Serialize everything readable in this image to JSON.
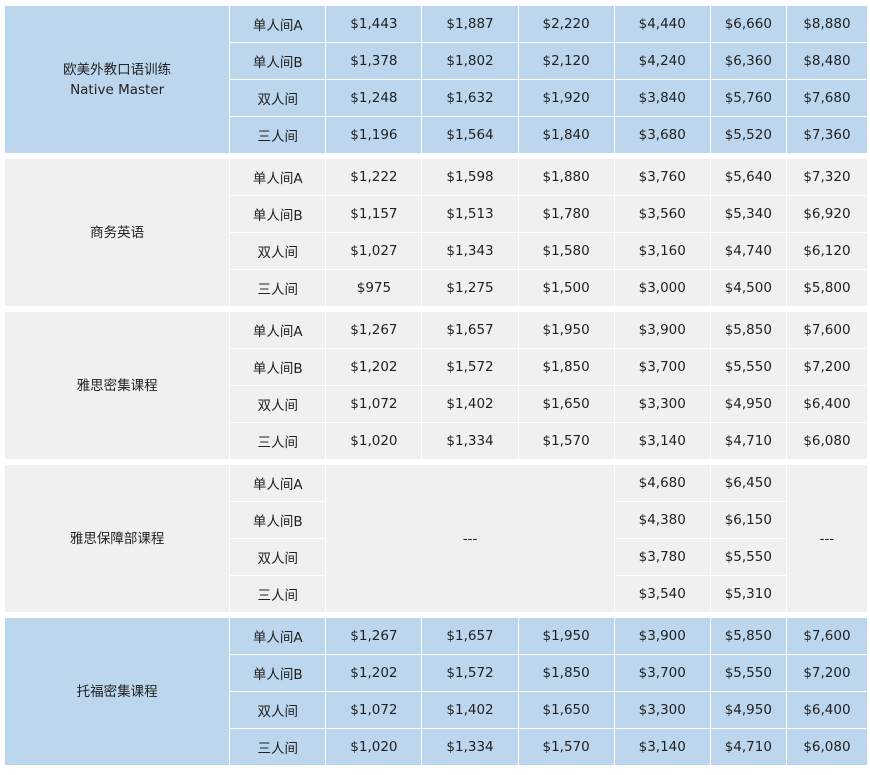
{
  "groups": [
    {
      "name": "欧美外教口语训练",
      "subtitle": "Native Master",
      "rows": [
        {
          "room": "单人间A",
          "prices": [
            "$1,443",
            "$1,887",
            "$2,220",
            "$4,440",
            "$6,660",
            "$8,880"
          ]
        },
        {
          "room": "单人间B",
          "prices": [
            "$1,378",
            "$1,802",
            "$2,120",
            "$4,240",
            "$6,360",
            "$8,480"
          ]
        },
        {
          "room": "双人间",
          "prices": [
            "$1,248",
            "$1,632",
            "$1,920",
            "$3,840",
            "$5,760",
            "$7,680"
          ]
        },
        {
          "room": "三人间",
          "prices": [
            "$1,196",
            "$1,564",
            "$1,840",
            "$3,680",
            "$5,520",
            "$7,360"
          ]
        }
      ]
    },
    {
      "name": "商务英语",
      "rows": [
        {
          "room": "单人间A",
          "prices": [
            "$1,222",
            "$1,598",
            "$1,880",
            "$3,760",
            "$5,640",
            "$7,320"
          ]
        },
        {
          "room": "单人间B",
          "prices": [
            "$1,157",
            "$1,513",
            "$1,780",
            "$3,560",
            "$5,340",
            "$6,920"
          ]
        },
        {
          "room": "双人间",
          "prices": [
            "$1,027",
            "$1,343",
            "$1,580",
            "$3,160",
            "$4,740",
            "$6,120"
          ]
        },
        {
          "room": "三人间",
          "prices": [
            "$975",
            "$1,275",
            "$1,500",
            "$3,000",
            "$4,500",
            "$5,800"
          ]
        }
      ]
    },
    {
      "name": "雅思密集课程",
      "rows": [
        {
          "room": "单人间A",
          "prices": [
            "$1,267",
            "$1,657",
            "$1,950",
            "$3,900",
            "$5,850",
            "$7,600"
          ]
        },
        {
          "room": "单人间B",
          "prices": [
            "$1,202",
            "$1,572",
            "$1,850",
            "$3,700",
            "$5,550",
            "$7,200"
          ]
        },
        {
          "room": "双人间",
          "prices": [
            "$1,072",
            "$1,402",
            "$1,650",
            "$3,300",
            "$4,950",
            "$6,400"
          ]
        },
        {
          "room": "三人间",
          "prices": [
            "$1,020",
            "$1,334",
            "$1,570",
            "$3,140",
            "$4,710",
            "$6,080"
          ]
        }
      ]
    },
    {
      "name": "雅思保障部课程",
      "na_left": "---",
      "na_right": "---",
      "rows": [
        {
          "room": "单人间A",
          "prices": [
            "$4,680",
            "$6,450"
          ]
        },
        {
          "room": "单人间B",
          "prices": [
            "$4,380",
            "$6,150"
          ]
        },
        {
          "room": "双人间",
          "prices": [
            "$3,780",
            "$5,550"
          ]
        },
        {
          "room": "三人间",
          "prices": [
            "$3,540",
            "$5,310"
          ]
        }
      ]
    },
    {
      "name": "托福密集课程",
      "rows": [
        {
          "room": "单人间A",
          "prices": [
            "$1,267",
            "$1,657",
            "$1,950",
            "$3,900",
            "$5,850",
            "$7,600"
          ]
        },
        {
          "room": "单人间B",
          "prices": [
            "$1,202",
            "$1,572",
            "$1,850",
            "$3,700",
            "$5,550",
            "$7,200"
          ]
        },
        {
          "room": "双人间",
          "prices": [
            "$1,072",
            "$1,402",
            "$1,650",
            "$3,300",
            "$4,950",
            "$6,400"
          ]
        },
        {
          "room": "三人间",
          "prices": [
            "$1,020",
            "$1,334",
            "$1,570",
            "$3,140",
            "$4,710",
            "$6,080"
          ]
        }
      ]
    }
  ],
  "colors": {
    "blue_row": "#bcd6ee",
    "gray_row": "#f0f0f0",
    "separator": "#ffffff"
  }
}
